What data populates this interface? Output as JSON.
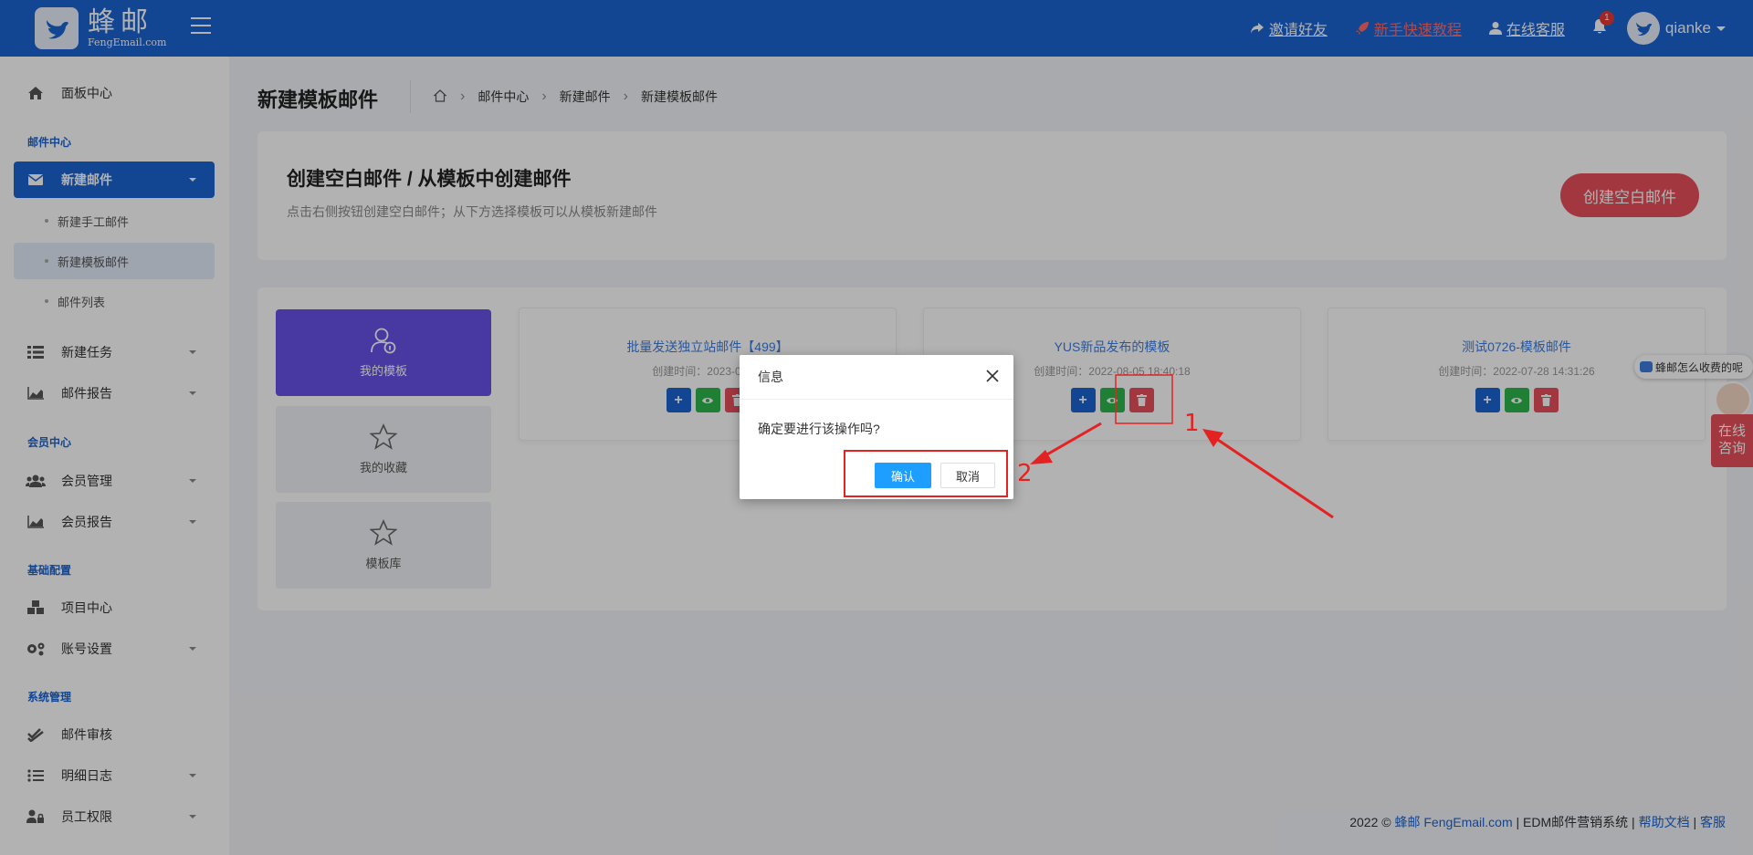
{
  "brand": {
    "name_cn": "蜂邮",
    "name_en": "FengEmail.com"
  },
  "topbar": {
    "invite": "邀请好友",
    "tutorial": "新手快速教程",
    "support": "在线客服",
    "notifications": "1",
    "username": "qianke"
  },
  "sidebar": {
    "dashboard": "面板中心",
    "section_mail": "邮件中心",
    "new_mail": "新建邮件",
    "sub_manual": "新建手工邮件",
    "sub_template": "新建模板邮件",
    "sub_list": "邮件列表",
    "new_task": "新建任务",
    "mail_report": "邮件报告",
    "section_member": "会员中心",
    "member_manage": "会员管理",
    "member_report": "会员报告",
    "section_config": "基础配置",
    "project_center": "项目中心",
    "account_settings": "账号设置",
    "section_system": "系统管理",
    "mail_audit": "邮件审核",
    "detail_log": "明细日志",
    "staff_permission": "员工权限"
  },
  "page": {
    "title": "新建模板邮件",
    "breadcrumb": [
      "邮件中心",
      "新建邮件",
      "新建模板邮件"
    ]
  },
  "intro": {
    "heading": "创建空白邮件 / 从模板中创建邮件",
    "description": "点击右侧按钮创建空白邮件；从下方选择模板可以从模板新建邮件",
    "create_button": "创建空白邮件"
  },
  "categories": [
    "我的模板",
    "我的收藏",
    "模板库"
  ],
  "templates": [
    {
      "title": "批量发送独立站邮件【499】",
      "time": "创建时间：2023-05-17"
    },
    {
      "title": "YUS新品发布的模板",
      "time": "创建时间：2022-08-05 18:40:18"
    },
    {
      "title": "测试0726-模板邮件",
      "time": "创建时间：2022-07-28 14:31:26"
    }
  ],
  "dialog": {
    "title": "信息",
    "message": "确定要进行该操作吗?",
    "confirm": "确认",
    "cancel": "取消"
  },
  "annotations": {
    "step1": "1",
    "step2": "2",
    "color": "#e52222"
  },
  "float": {
    "chat": "蜂邮怎么收费的呢",
    "consult_line1": "在线",
    "consult_line2": "咨询"
  },
  "footer": {
    "prefix": "2022 ©",
    "brand": "蜂邮 FengEmail.com",
    "system": "| EDM邮件营销系统 |",
    "help": "帮助文档",
    "sep": "|",
    "service": "客服"
  },
  "colors": {
    "primary": "#1a64d2",
    "danger": "#e8505b",
    "accent_purple": "#6751e8",
    "success": "#2db84d"
  }
}
